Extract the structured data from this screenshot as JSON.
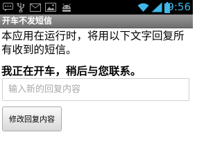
{
  "status_bar": {
    "time": "9:56",
    "icons": [
      "sms-icon",
      "usb-icon",
      "mail-icon",
      "photo-icon",
      "android-icon",
      "wifi-icon",
      "signal-icon",
      "battery-icon"
    ]
  },
  "app": {
    "title": "开车不发短信"
  },
  "main": {
    "description": "本应用在运行时，将用以下文字回复所有收到的短信。",
    "current_reply": "我正在开车，稍后与您联系。",
    "input_placeholder": "输入新的回复内容",
    "input_value": "",
    "modify_button_label": "修改回复内容"
  }
}
